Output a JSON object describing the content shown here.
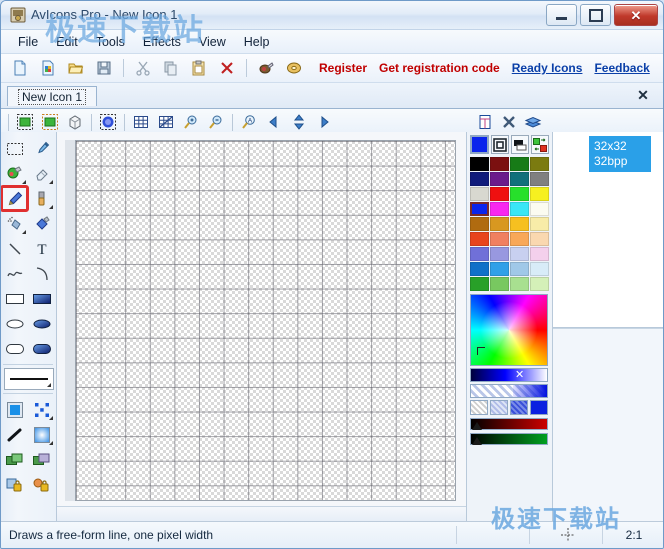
{
  "window": {
    "title": "AvIcons Pro - New Icon 1",
    "caption_buttons": {
      "minimize": "minimize-button",
      "maximize": "maximize-button",
      "close": "✕"
    }
  },
  "menubar": {
    "items": [
      {
        "label": "File"
      },
      {
        "label": "Edit"
      },
      {
        "label": "Tools"
      },
      {
        "label": "Effects"
      },
      {
        "label": "View"
      },
      {
        "label": "Help"
      }
    ]
  },
  "toolbar": {
    "buttons": [
      {
        "name": "new-icon-button",
        "icon": "new-file-icon"
      },
      {
        "name": "new-image-button",
        "icon": "new-image-icon"
      },
      {
        "name": "open-button",
        "icon": "open-folder-icon"
      },
      {
        "name": "save-button",
        "icon": "floppy-save-icon"
      },
      {
        "name": "cut-button",
        "icon": "scissors-icon"
      },
      {
        "name": "copy-button",
        "icon": "copy-icon"
      },
      {
        "name": "paste-button",
        "icon": "clipboard-paste-icon"
      },
      {
        "name": "delete-button",
        "icon": "red-x-icon"
      },
      {
        "name": "capture-button",
        "icon": "camera-icon"
      },
      {
        "name": "help-book-button",
        "icon": "book-icon"
      }
    ],
    "links": [
      {
        "label": "Register",
        "style": "red"
      },
      {
        "label": "Get registration code",
        "style": "red"
      },
      {
        "label": "Ready Icons",
        "style": "blue"
      },
      {
        "label": "Feedback",
        "style": "blue"
      }
    ]
  },
  "tabs": {
    "items": [
      {
        "label": "New Icon 1",
        "active": true
      }
    ],
    "close_glyph": "✕"
  },
  "toolbar2": {
    "buttons": [
      {
        "name": "image-select-green-button",
        "icon": "green-box-select-icon"
      },
      {
        "name": "image-select-orange-button",
        "icon": "orange-box-select-icon"
      },
      {
        "name": "cube-3d-button",
        "icon": "cube-icon"
      },
      {
        "name": "blur-select-button",
        "icon": "blue-blob-select-icon"
      },
      {
        "name": "grid-button",
        "icon": "grid-icon"
      },
      {
        "name": "pixel-grid-button",
        "icon": "pixel-grid-icon"
      },
      {
        "name": "zoom-in-button",
        "icon": "magnifier-plus-icon"
      },
      {
        "name": "zoom-out-button",
        "icon": "magnifier-minus-icon"
      },
      {
        "name": "antialias-button",
        "icon": "magnifier-a-icon"
      },
      {
        "name": "nav-left-button",
        "icon": "arrow-left-icon"
      },
      {
        "name": "nav-updown-button",
        "icon": "arrow-up-down-icon"
      },
      {
        "name": "nav-right-button",
        "icon": "arrow-right-icon"
      }
    ],
    "right_buttons": [
      {
        "name": "new-image-format-button",
        "icon": "page-format-icon"
      },
      {
        "name": "delete-image-button",
        "icon": "delete-x-icon"
      },
      {
        "name": "layers-button",
        "icon": "layers-icon"
      }
    ]
  },
  "tools": {
    "selected": "pencil-tool",
    "items": [
      {
        "name": "rect-select-tool",
        "icon": "marquee-icon",
        "sub": false
      },
      {
        "name": "color-picker-tool",
        "icon": "eyedropper-icon",
        "sub": false
      },
      {
        "name": "fill-tool",
        "icon": "paint-bucket-icon",
        "sub": true
      },
      {
        "name": "eraser-tool",
        "icon": "eraser-icon",
        "sub": true
      },
      {
        "name": "pencil-tool",
        "icon": "pencil-icon",
        "sub": false
      },
      {
        "name": "brush-tool",
        "icon": "brush-icon",
        "sub": true
      },
      {
        "name": "airbrush-tool",
        "icon": "spray-can-icon",
        "sub": true
      },
      {
        "name": "flood-fill-tool",
        "icon": "bucket-pour-icon",
        "sub": false
      },
      {
        "name": "line-tool",
        "icon": "line-icon",
        "sub": false
      },
      {
        "name": "text-tool",
        "icon": "text-t-icon",
        "sub": false
      },
      {
        "name": "curve-tool",
        "icon": "wave-curve-icon",
        "sub": false
      },
      {
        "name": "arc-tool",
        "icon": "arc-icon",
        "sub": false
      },
      {
        "name": "rectangle-outline-tool",
        "icon": "rectangle-icon",
        "sub": false
      },
      {
        "name": "rectangle-filled-tool",
        "icon": "rectangle-filled-icon",
        "sub": false
      },
      {
        "name": "ellipse-outline-tool",
        "icon": "ellipse-icon",
        "sub": false
      },
      {
        "name": "ellipse-filled-tool",
        "icon": "ellipse-filled-icon",
        "sub": false
      },
      {
        "name": "rounded-rect-outline-tool",
        "icon": "rounded-rect-icon",
        "sub": false
      },
      {
        "name": "rounded-rect-filled-tool",
        "icon": "rounded-rect-filled-icon",
        "sub": false
      },
      {
        "name": "solid-fill-style",
        "icon": "solid-square-icon",
        "sub": false
      },
      {
        "name": "pattern-fill-style",
        "icon": "pattern-dots-icon",
        "sub": true
      },
      {
        "name": "stroke-style",
        "icon": "stroke-brush-icon",
        "sub": false
      },
      {
        "name": "gradient-fill-style",
        "icon": "gradient-square-icon",
        "sub": true
      },
      {
        "name": "move-layer-tool",
        "icon": "green-layers-icon",
        "sub": false
      },
      {
        "name": "copy-layer-tool",
        "icon": "purple-layers-icon",
        "sub": false
      },
      {
        "name": "lock-image-tool",
        "icon": "lock-blue-icon",
        "sub": false
      },
      {
        "name": "lock-color-tool",
        "icon": "lock-orange-icon",
        "sub": false
      }
    ],
    "line_width_label": "line-width-selector"
  },
  "color_panel": {
    "current_color": "#0a24ec",
    "top_tools": [
      {
        "name": "foreground-color-swatch",
        "icon": "color-swatch"
      },
      {
        "name": "transparency-mask-button",
        "icon": "frame-target-icon"
      },
      {
        "name": "opacity-button",
        "icon": "opacity-icon"
      },
      {
        "name": "swap-colors-button",
        "icon": "swap-colors-icon"
      }
    ],
    "palette": [
      [
        "#000000",
        "#7b1010",
        "#177b17",
        "#7b7b10"
      ],
      [
        "#101b7b",
        "#6b1b8c",
        "#10707b",
        "#808080"
      ],
      [
        "#d8d8d0",
        "#ef1010",
        "#27e02b",
        "#f6f020"
      ],
      [
        "#0a24ec",
        "#f828f0",
        "#3ae6f6",
        "#fbfbf0"
      ],
      [
        "#b06b10",
        "#d89820",
        "#f6c020",
        "#f8eca8"
      ],
      [
        "#e8441c",
        "#f08060",
        "#f8a858",
        "#fad8b0"
      ],
      [
        "#7070d8",
        "#9898e0",
        "#c8d0f0",
        "#f4d0ec"
      ],
      [
        "#1070c8",
        "#30a0e8",
        "#a0c8e8",
        "#d8ecf8"
      ],
      [
        "#28a028",
        "#78c860",
        "#a8e090",
        "#d4f0b8"
      ]
    ],
    "selected_index": [
      3,
      0
    ],
    "pattern_swatches": [
      "hatch-white",
      "hatch-light-blue",
      "hatch-blue",
      "solid-blue"
    ],
    "sliders": [
      {
        "name": "red-channel-slider",
        "color": "#cc0000"
      },
      {
        "name": "green-channel-slider",
        "color": "#00a020"
      }
    ]
  },
  "image_list": {
    "items": [
      {
        "size": "32x32",
        "depth": "32bpp",
        "selected": true
      }
    ]
  },
  "statusbar": {
    "hint": "Draws a free-form line, one pixel width",
    "coords": "",
    "zoom": "2:1"
  },
  "watermark": {
    "top": "极速下载站",
    "bottom": "极速下载站"
  }
}
